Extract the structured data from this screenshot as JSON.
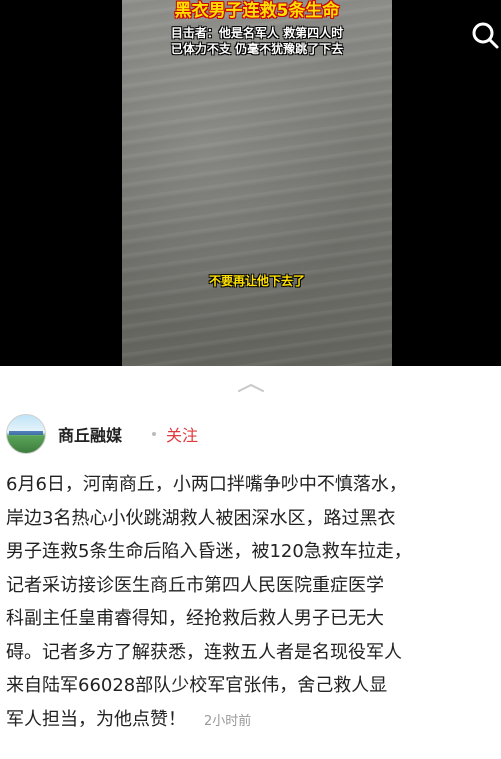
{
  "video": {
    "title": "黑衣男子连救5条生命",
    "subtitle_line1": "目击者：他是名军人 救第四人时",
    "subtitle_line2": "已体力不支 仍毫不犹豫跳了下去",
    "caption": "不要再让他下去了"
  },
  "header": {
    "search_icon": "search-icon"
  },
  "author": {
    "name": "商丘融媒",
    "follow_label": "关注",
    "follow_color": "#e0393e"
  },
  "post": {
    "lines": [
      "6月6日，河南商丘，小两口拌嘴争吵中不慎落水，",
      "岸边3名热心小伙跳湖救人被困深水区，路过黑衣",
      "男子连救5条生命后陷入昏迷，被120急救车拉走，",
      "记者采访接诊医生商丘市第四人民医院重症医学",
      "科副主任皇甫睿得知，经抢救后救人男子已无大",
      "碍。记者多方了解获悉，连救五人者是名现役军人",
      "来自陆军66028部队少校军官张伟，舍己救人显",
      "军人担当，为他点赞！"
    ],
    "time": "2小时前"
  }
}
